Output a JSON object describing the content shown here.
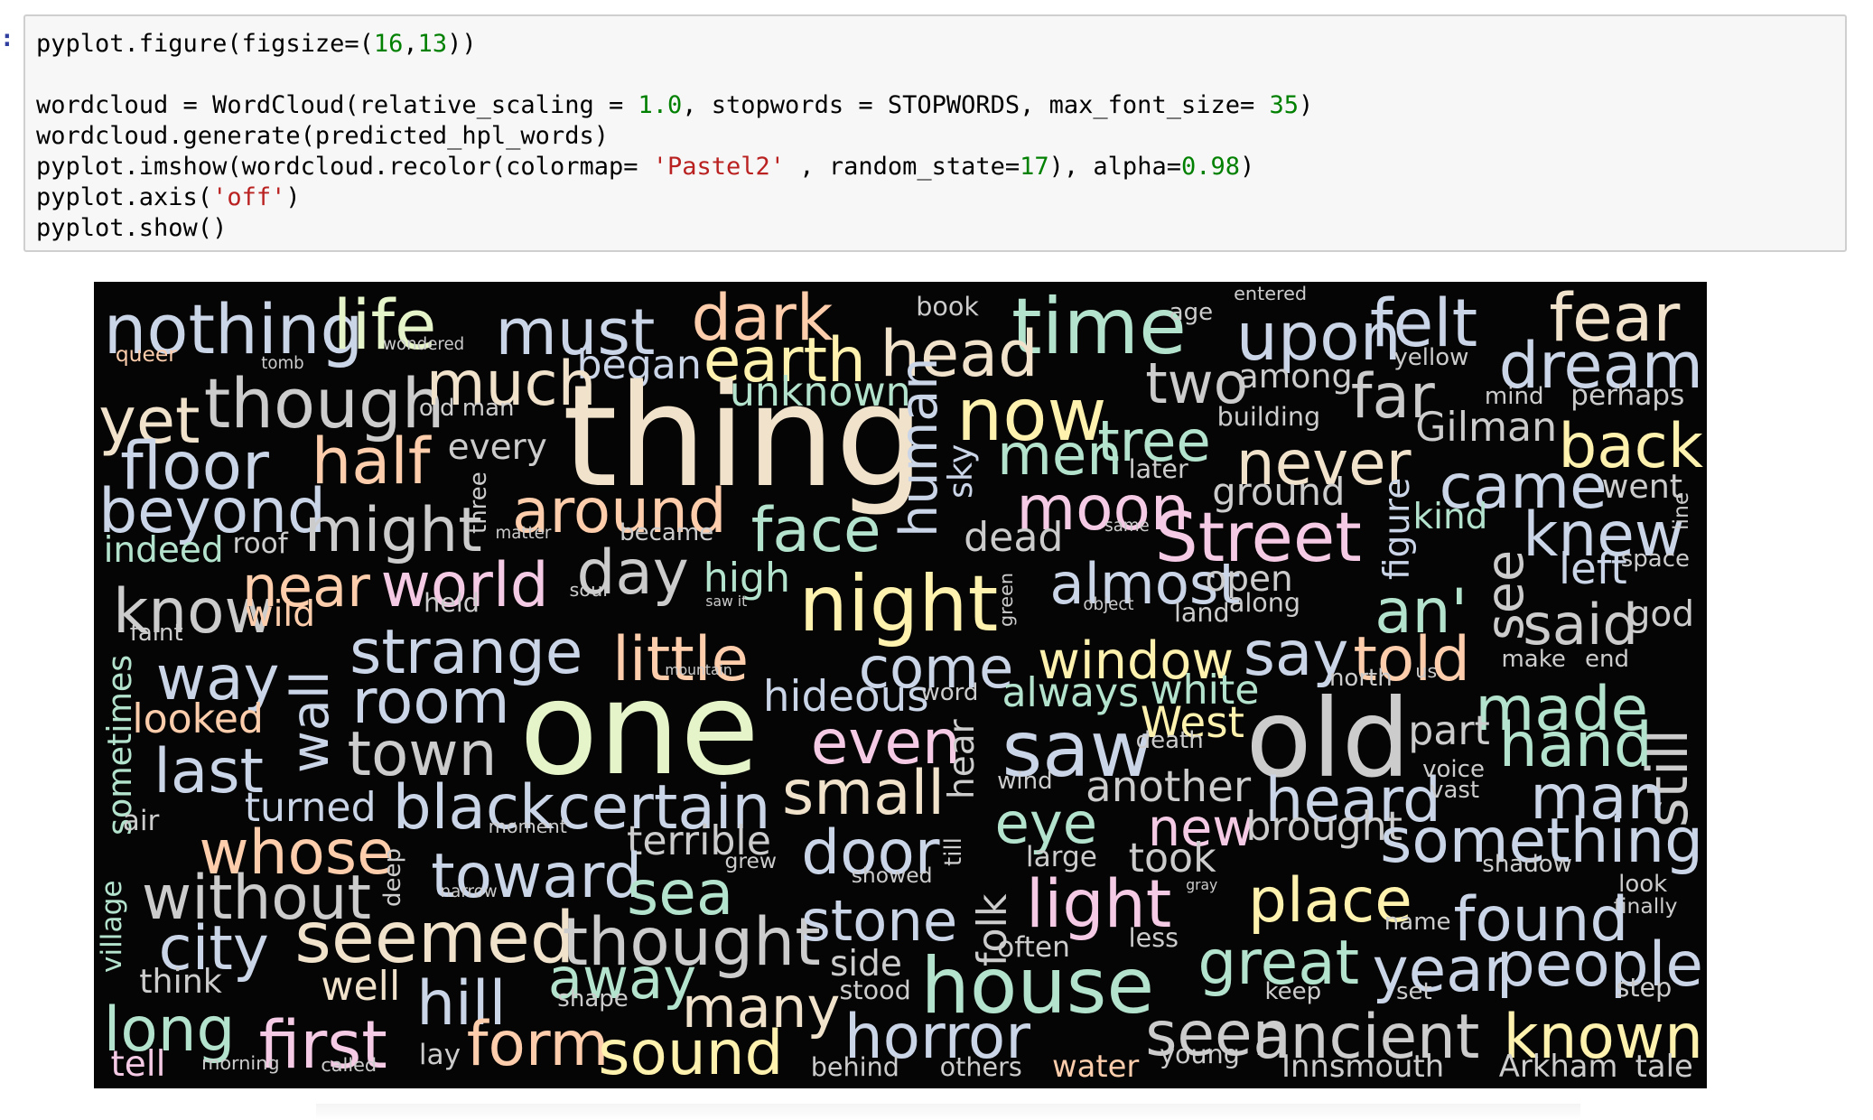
{
  "cell": {
    "prompt_marker": ":",
    "lines": [
      {
        "parts": [
          {
            "t": "pyplot.figure(figsize=("
          },
          {
            "t": "16",
            "c": "num"
          },
          {
            "t": ","
          },
          {
            "t": "13",
            "c": "num"
          },
          {
            "t": "))"
          }
        ]
      },
      {
        "parts": []
      },
      {
        "parts": [
          {
            "t": "wordcloud = WordCloud(relative_scaling = "
          },
          {
            "t": "1.0",
            "c": "num"
          },
          {
            "t": ", stopwords = STOPWORDS, max_font_size= "
          },
          {
            "t": "35",
            "c": "num"
          },
          {
            "t": ")"
          }
        ]
      },
      {
        "parts": [
          {
            "t": "wordcloud.generate(predicted_hpl_words)"
          }
        ]
      },
      {
        "parts": [
          {
            "t": "pyplot.imshow(wordcloud.recolor(colormap= "
          },
          {
            "t": "'Pastel2'",
            "c": "str"
          },
          {
            "t": " , random_state="
          },
          {
            "t": "17",
            "c": "num"
          },
          {
            "t": "), alpha="
          },
          {
            "t": "0.98",
            "c": "num"
          },
          {
            "t": ")"
          }
        ]
      },
      {
        "parts": [
          {
            "t": "pyplot.axis("
          },
          {
            "t": "'off'",
            "c": "str"
          },
          {
            "t": ")"
          }
        ]
      },
      {
        "parts": [
          {
            "t": "pyplot.show()"
          }
        ]
      }
    ]
  },
  "palette": {
    "green": "#b3e2cd",
    "orange": "#fdcdac",
    "blue": "#cbd5e8",
    "pink": "#f4cae4",
    "lime": "#e6f5c9",
    "yellow": "#fff2ae",
    "tan": "#f1e2cc",
    "grey": "#cccccc",
    "background": "#050505"
  },
  "wordcloud": [
    {
      "w": "nothing",
      "c": "blue",
      "s": 58
    },
    {
      "w": "life",
      "c": "lime",
      "s": 58
    },
    {
      "w": "must",
      "c": "blue",
      "s": 54
    },
    {
      "w": "dark",
      "c": "orange",
      "s": 54
    },
    {
      "w": "book",
      "c": "grey",
      "s": 22
    },
    {
      "w": "time",
      "c": "green",
      "s": 66
    },
    {
      "w": "age",
      "c": "grey",
      "s": 20
    },
    {
      "w": "entered",
      "c": "grey",
      "s": 16
    },
    {
      "w": "upon",
      "c": "blue",
      "s": 56
    },
    {
      "w": "felt",
      "c": "blue",
      "s": 56
    },
    {
      "w": "fear",
      "c": "tan",
      "s": 56
    },
    {
      "w": "queer",
      "c": "orange",
      "s": 18
    },
    {
      "w": "tomb",
      "c": "grey",
      "s": 14
    },
    {
      "w": "wondered",
      "c": "grey",
      "s": 14
    },
    {
      "w": "began",
      "c": "blue",
      "s": 34
    },
    {
      "w": "earth",
      "c": "yellow",
      "s": 52
    },
    {
      "w": "head",
      "c": "tan",
      "s": 54
    },
    {
      "w": "yellow",
      "c": "grey",
      "s": 20
    },
    {
      "w": "dream",
      "c": "blue",
      "s": 54
    },
    {
      "w": "yet",
      "c": "tan",
      "s": 54
    },
    {
      "w": "though",
      "c": "grey",
      "s": 58
    },
    {
      "w": "much",
      "c": "tan",
      "s": 52
    },
    {
      "w": "old man",
      "c": "grey",
      "s": 20
    },
    {
      "w": "unknown",
      "c": "green",
      "s": 34
    },
    {
      "w": "two",
      "c": "grey",
      "s": 48
    },
    {
      "w": "among",
      "c": "grey",
      "s": 28
    },
    {
      "w": "far",
      "c": "grey",
      "s": 52
    },
    {
      "w": "mind",
      "c": "grey",
      "s": 20
    },
    {
      "w": "perhaps",
      "c": "grey",
      "s": 24
    },
    {
      "w": "thing",
      "c": "tan",
      "s": 120
    },
    {
      "w": "now",
      "c": "yellow",
      "s": 62
    },
    {
      "w": "building",
      "c": "grey",
      "s": 22
    },
    {
      "w": "Gilman",
      "c": "grey",
      "s": 34
    },
    {
      "w": "floor",
      "c": "blue",
      "s": 56
    },
    {
      "w": "half",
      "c": "orange",
      "s": 54
    },
    {
      "w": "every",
      "c": "grey",
      "s": 30
    },
    {
      "w": "human",
      "c": "blue",
      "s": 44
    },
    {
      "w": "sky",
      "c": "blue",
      "s": 28
    },
    {
      "w": "men",
      "c": "green",
      "s": 48
    },
    {
      "w": "tree",
      "c": "green",
      "s": 48
    },
    {
      "w": "never",
      "c": "tan",
      "s": 52
    },
    {
      "w": "back",
      "c": "yellow",
      "s": 52
    },
    {
      "w": "later",
      "c": "grey",
      "s": 22
    },
    {
      "w": "beyond",
      "c": "blue",
      "s": 52
    },
    {
      "w": "around",
      "c": "orange",
      "s": 52
    },
    {
      "w": "ground",
      "c": "grey",
      "s": 32
    },
    {
      "w": "came",
      "c": "blue",
      "s": 52
    },
    {
      "w": "went",
      "c": "grey",
      "s": 28
    },
    {
      "w": "might",
      "c": "grey",
      "s": 52
    },
    {
      "w": "three",
      "c": "grey",
      "s": 20
    },
    {
      "w": "matter",
      "c": "grey",
      "s": 14
    },
    {
      "w": "became",
      "c": "grey",
      "s": 20
    },
    {
      "w": "face",
      "c": "green",
      "s": 52
    },
    {
      "w": "moon",
      "c": "pink",
      "s": 52
    },
    {
      "w": "kind",
      "c": "green",
      "s": 30
    },
    {
      "w": "knew",
      "c": "blue",
      "s": 52
    },
    {
      "w": "indeed",
      "c": "green",
      "s": 30
    },
    {
      "w": "roof",
      "c": "grey",
      "s": 24
    },
    {
      "w": "dead",
      "c": "grey",
      "s": 34
    },
    {
      "w": "same",
      "c": "grey",
      "s": 14
    },
    {
      "w": "Street",
      "c": "pink",
      "s": 58
    },
    {
      "w": "figure",
      "c": "blue",
      "s": 30
    },
    {
      "w": "line",
      "c": "grey",
      "s": 18
    },
    {
      "w": "left",
      "c": "blue",
      "s": 36
    },
    {
      "w": "space",
      "c": "grey",
      "s": 20
    },
    {
      "w": "know",
      "c": "grey",
      "s": 52
    },
    {
      "w": "near",
      "c": "orange",
      "s": 48
    },
    {
      "w": "world",
      "c": "pink",
      "s": 52
    },
    {
      "w": "day",
      "c": "grey",
      "s": 52
    },
    {
      "w": "high",
      "c": "green",
      "s": 34
    },
    {
      "w": "night",
      "c": "yellow",
      "s": 66
    },
    {
      "w": "almost",
      "c": "blue",
      "s": 48
    },
    {
      "w": "open",
      "c": "grey",
      "s": 30
    },
    {
      "w": "an'",
      "c": "green",
      "s": 52
    },
    {
      "w": "see",
      "c": "grey",
      "s": 44
    },
    {
      "w": "said",
      "c": "grey",
      "s": 48
    },
    {
      "w": "god",
      "c": "grey",
      "s": 30
    },
    {
      "w": "wild",
      "c": "orange",
      "s": 30
    },
    {
      "w": "held",
      "c": "grey",
      "s": 22
    },
    {
      "w": "soul",
      "c": "grey",
      "s": 16
    },
    {
      "w": "saw it",
      "c": "grey",
      "s": 12
    },
    {
      "w": "green",
      "c": "grey",
      "s": 16
    },
    {
      "w": "object",
      "c": "grey",
      "s": 14
    },
    {
      "w": "land",
      "c": "grey",
      "s": 22
    },
    {
      "w": "along",
      "c": "grey",
      "s": 22
    },
    {
      "w": "faint",
      "c": "grey",
      "s": 20
    },
    {
      "w": "way",
      "c": "blue",
      "s": 52
    },
    {
      "w": "strange",
      "c": "blue",
      "s": 52
    },
    {
      "w": "little",
      "c": "orange",
      "s": 52
    },
    {
      "w": "come",
      "c": "blue",
      "s": 48
    },
    {
      "w": "window",
      "c": "yellow",
      "s": 44
    },
    {
      "w": "say",
      "c": "blue",
      "s": 52
    },
    {
      "w": "told",
      "c": "orange",
      "s": 52
    },
    {
      "w": "make",
      "c": "grey",
      "s": 20
    },
    {
      "w": "end",
      "c": "grey",
      "s": 20
    },
    {
      "w": "sometimes",
      "c": "green",
      "s": 28
    },
    {
      "w": "wall",
      "c": "blue",
      "s": 44
    },
    {
      "w": "room",
      "c": "blue",
      "s": 52
    },
    {
      "w": "mountain",
      "c": "grey",
      "s": 12
    },
    {
      "w": "hideous",
      "c": "blue",
      "s": 36
    },
    {
      "w": "word",
      "c": "grey",
      "s": 20
    },
    {
      "w": "always",
      "c": "green",
      "s": 34
    },
    {
      "w": "white",
      "c": "green",
      "s": 34
    },
    {
      "w": "north",
      "c": "grey",
      "s": 20
    },
    {
      "w": "us",
      "c": "grey",
      "s": 16
    },
    {
      "w": "made",
      "c": "green",
      "s": 52
    },
    {
      "w": "still",
      "c": "grey",
      "s": 48
    },
    {
      "w": "looked",
      "c": "orange",
      "s": 34
    },
    {
      "w": "one",
      "c": "lime",
      "s": 110
    },
    {
      "w": "even",
      "c": "pink",
      "s": 52
    },
    {
      "w": "saw",
      "c": "blue",
      "s": 66
    },
    {
      "w": "West",
      "c": "yellow",
      "s": 36
    },
    {
      "w": "death",
      "c": "grey",
      "s": 20
    },
    {
      "w": "old",
      "c": "grey",
      "s": 92
    },
    {
      "w": "part",
      "c": "grey",
      "s": 34
    },
    {
      "w": "hand",
      "c": "green",
      "s": 52
    },
    {
      "w": "last",
      "c": "blue",
      "s": 52
    },
    {
      "w": "town",
      "c": "grey",
      "s": 52
    },
    {
      "w": "hear",
      "c": "grey",
      "s": 30
    },
    {
      "w": "wind",
      "c": "grey",
      "s": 20
    },
    {
      "w": "another",
      "c": "grey",
      "s": 36
    },
    {
      "w": "heard",
      "c": "blue",
      "s": 52
    },
    {
      "w": "voice",
      "c": "grey",
      "s": 20
    },
    {
      "w": "vast",
      "c": "grey",
      "s": 20
    },
    {
      "w": "man",
      "c": "blue",
      "s": 52
    },
    {
      "w": "turned",
      "c": "blue",
      "s": 34
    },
    {
      "w": "black",
      "c": "blue",
      "s": 52
    },
    {
      "w": "certain",
      "c": "blue",
      "s": 52
    },
    {
      "w": "small",
      "c": "tan",
      "s": 52
    },
    {
      "w": "eye",
      "c": "green",
      "s": 48
    },
    {
      "w": "new",
      "c": "pink",
      "s": 44
    },
    {
      "w": "brought",
      "c": "grey",
      "s": 34
    },
    {
      "w": "air",
      "c": "grey",
      "s": 24
    },
    {
      "w": "till",
      "c": "grey",
      "s": 20
    },
    {
      "w": "moment",
      "c": "grey",
      "s": 16
    },
    {
      "w": "whose",
      "c": "orange",
      "s": 52
    },
    {
      "w": "terrible",
      "c": "grey",
      "s": 34
    },
    {
      "w": "door",
      "c": "blue",
      "s": 52
    },
    {
      "w": "something",
      "c": "blue",
      "s": 52
    },
    {
      "w": "village",
      "c": "green",
      "s": 24
    },
    {
      "w": "deep",
      "c": "grey",
      "s": 20
    },
    {
      "w": "toward",
      "c": "blue",
      "s": 52
    },
    {
      "w": "grew",
      "c": "grey",
      "s": 18
    },
    {
      "w": "large",
      "c": "grey",
      "s": 24
    },
    {
      "w": "took",
      "c": "grey",
      "s": 34
    },
    {
      "w": "shadow",
      "c": "grey",
      "s": 20
    },
    {
      "w": "without",
      "c": "grey",
      "s": 52
    },
    {
      "w": "narrow",
      "c": "grey",
      "s": 14
    },
    {
      "w": "sea",
      "c": "green",
      "s": 52
    },
    {
      "w": "showed",
      "c": "grey",
      "s": 18
    },
    {
      "w": "folk",
      "c": "grey",
      "s": 34
    },
    {
      "w": "light",
      "c": "pink",
      "s": 56
    },
    {
      "w": "gray",
      "c": "grey",
      "s": 12
    },
    {
      "w": "place",
      "c": "yellow",
      "s": 52
    },
    {
      "w": "look",
      "c": "grey",
      "s": 20
    },
    {
      "w": "finally",
      "c": "grey",
      "s": 18
    },
    {
      "w": "city",
      "c": "blue",
      "s": 52
    },
    {
      "w": "seemed",
      "c": "tan",
      "s": 60
    },
    {
      "w": "thought",
      "c": "grey",
      "s": 56
    },
    {
      "w": "stone",
      "c": "blue",
      "s": 48
    },
    {
      "w": "often",
      "c": "grey",
      "s": 24
    },
    {
      "w": "less",
      "c": "grey",
      "s": 22
    },
    {
      "w": "name",
      "c": "grey",
      "s": 20
    },
    {
      "w": "found",
      "c": "blue",
      "s": 52
    },
    {
      "w": "think",
      "c": "grey",
      "s": 28
    },
    {
      "w": "well",
      "c": "tan",
      "s": 34
    },
    {
      "w": "away",
      "c": "green",
      "s": 48
    },
    {
      "w": "side",
      "c": "grey",
      "s": 30
    },
    {
      "w": "house",
      "c": "green",
      "s": 66
    },
    {
      "w": "great",
      "c": "green",
      "s": 52
    },
    {
      "w": "year",
      "c": "blue",
      "s": 52
    },
    {
      "w": "people",
      "c": "blue",
      "s": 52
    },
    {
      "w": "hill",
      "c": "blue",
      "s": 52
    },
    {
      "w": "shape",
      "c": "grey",
      "s": 20
    },
    {
      "w": "stood",
      "c": "grey",
      "s": 22
    },
    {
      "w": "many",
      "c": "tan",
      "s": 48
    },
    {
      "w": "keep",
      "c": "grey",
      "s": 20
    },
    {
      "w": "set",
      "c": "grey",
      "s": 20
    },
    {
      "w": "step",
      "c": "grey",
      "s": 22
    },
    {
      "w": "long",
      "c": "green",
      "s": 52
    },
    {
      "w": "first",
      "c": "pink",
      "s": 56
    },
    {
      "w": "form",
      "c": "orange",
      "s": 52
    },
    {
      "w": "sound",
      "c": "yellow",
      "s": 52
    },
    {
      "w": "horror",
      "c": "blue",
      "s": 52
    },
    {
      "w": "seen",
      "c": "grey",
      "s": 52
    },
    {
      "w": "ancient",
      "c": "grey",
      "s": 52
    },
    {
      "w": "known",
      "c": "yellow",
      "s": 52
    },
    {
      "w": "tell",
      "c": "pink",
      "s": 30
    },
    {
      "w": "morning",
      "c": "grey",
      "s": 16
    },
    {
      "w": "called",
      "c": "grey",
      "s": 16
    },
    {
      "w": "lay",
      "c": "grey",
      "s": 24
    },
    {
      "w": "behind",
      "c": "grey",
      "s": 22
    },
    {
      "w": "others",
      "c": "grey",
      "s": 22
    },
    {
      "w": "water",
      "c": "orange",
      "s": 26
    },
    {
      "w": "young",
      "c": "grey",
      "s": 22
    },
    {
      "w": "Innsmouth",
      "c": "grey",
      "s": 26
    },
    {
      "w": "Arkham",
      "c": "grey",
      "s": 26
    },
    {
      "w": "tale",
      "c": "grey",
      "s": 26
    }
  ]
}
